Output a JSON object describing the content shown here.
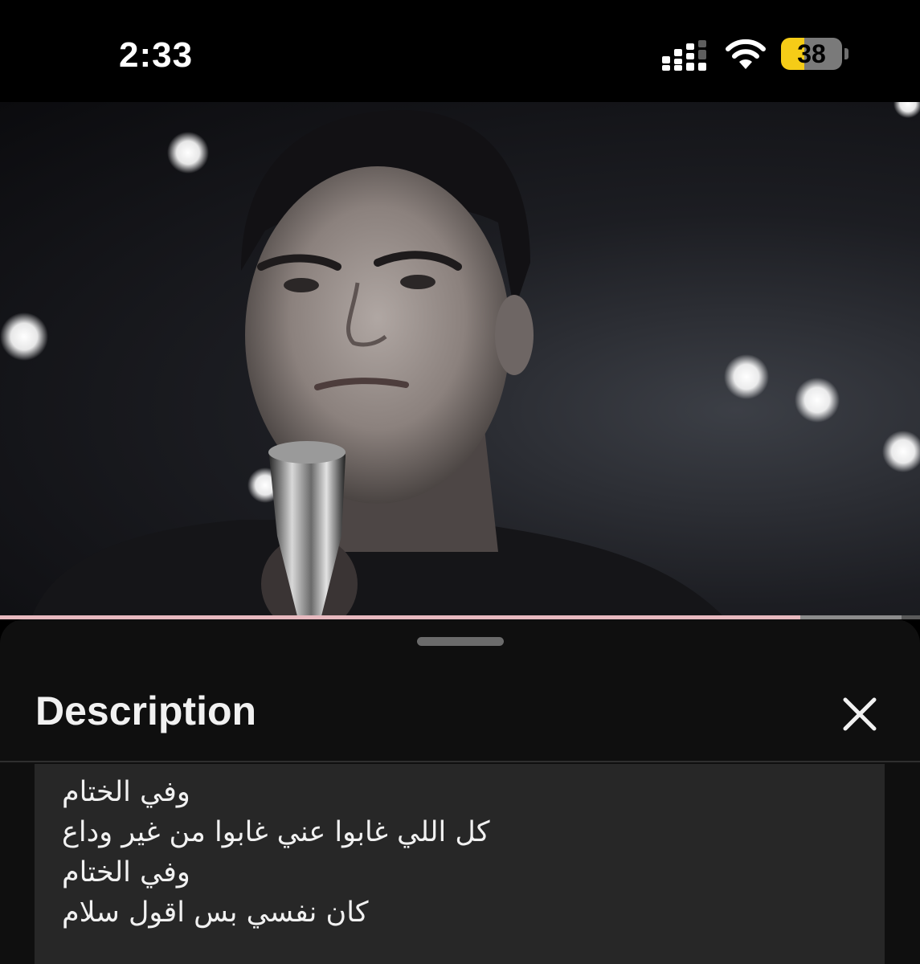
{
  "status_bar": {
    "time": "2:33",
    "battery_level": "38",
    "icons": [
      "cellular-signal-icon",
      "wifi-icon",
      "battery-icon"
    ]
  },
  "video": {
    "progress_fraction": 0.87,
    "buffered_fraction": 0.98,
    "progress_color": "#e7b9bf"
  },
  "description_panel": {
    "title": "Description",
    "close_icon": "close-icon",
    "lyrics": [
      "وفي الختام",
      "كل اللي غابوا عني غابوا من غير وداع",
      "وفي الختام",
      "كان نفسي بس اقول سلام"
    ]
  },
  "colors": {
    "sheet_background": "#0f0f0f",
    "lyrics_background": "#272727",
    "battery_low_power": "#f5cc17"
  }
}
